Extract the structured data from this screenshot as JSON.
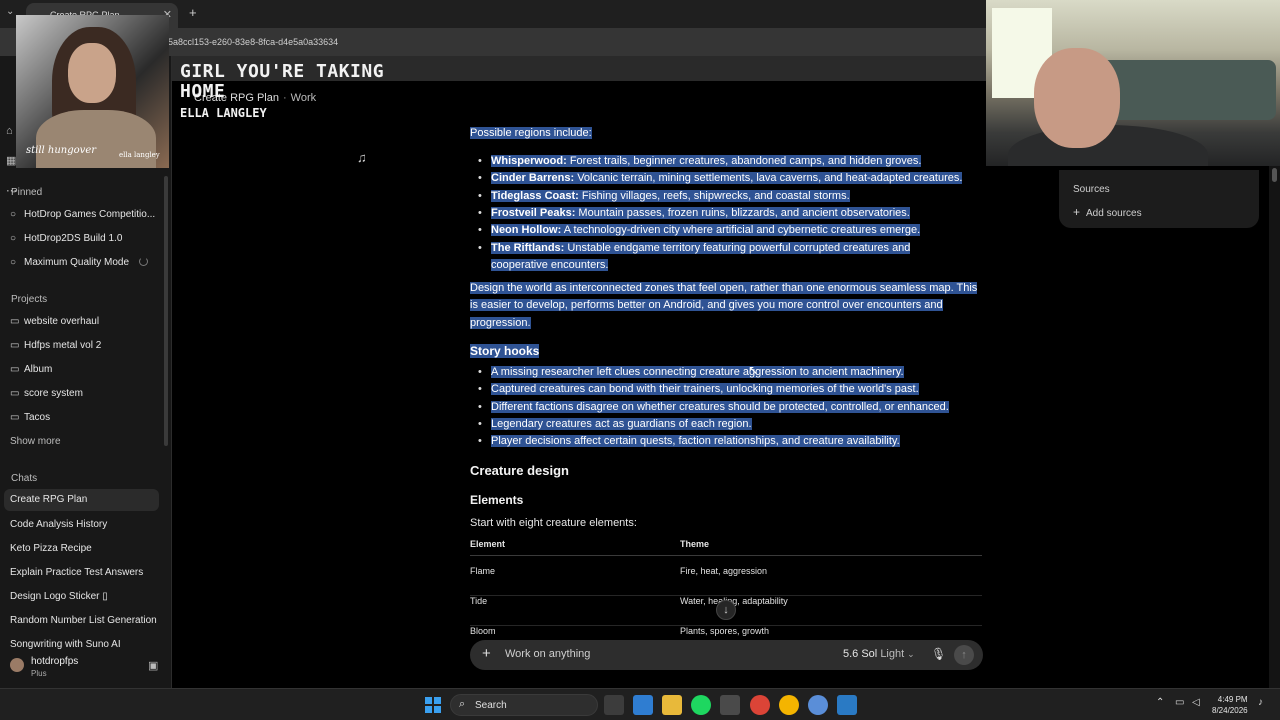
{
  "browser": {
    "tab_title": "Create RPG Plan",
    "url": "5a8ccl153-e260-83e8-8fca-d4e5a0a33634"
  },
  "overlay": {
    "song_title": "GIRL YOU'RE TAKING HOME",
    "song_artist": "ELLA LANGLEY",
    "album_script": "still hungover",
    "album_artist": "ella langley"
  },
  "breadcrumb": {
    "chat": "Create RPG Plan",
    "separator": "·",
    "project": "Work"
  },
  "sidebar": {
    "pinned_label": "Pinned",
    "pinned": [
      "HotDrop Games Competitio...",
      "HotDrop2DS Build 1.0",
      "Maximum Quality Mode"
    ],
    "projects_label": "Projects",
    "projects": [
      "website overhaul",
      "Hdfps metal vol 2",
      "Album",
      "score system",
      "Tacos"
    ],
    "show_more": "Show more",
    "chats_label": "Chats",
    "chats": [
      "Create RPG Plan",
      "Code Analysis History",
      "Keto Pizza Recipe",
      "Explain Practice Test Answers",
      "Design Logo Sticker ▯",
      "Random Number List Generation",
      "Songwriting with Suno AI"
    ],
    "user_name": "hotdropfps",
    "user_plan": "Plus"
  },
  "sources": {
    "title": "Sources",
    "add": "Add sources"
  },
  "content": {
    "regions_intro": "Possible regions include:",
    "regions": [
      {
        "name": "Whisperwood:",
        "text": " Forest trails, beginner creatures, abandoned camps, and hidden groves."
      },
      {
        "name": "Cinder Barrens:",
        "text": " Volcanic terrain, mining settlements, lava caverns, and heat-adapted creatures."
      },
      {
        "name": "Tideglass Coast:",
        "text": " Fishing villages, reefs, shipwrecks, and coastal storms."
      },
      {
        "name": "Frostveil Peaks:",
        "text": " Mountain passes, frozen ruins, blizzards, and ancient observatories."
      },
      {
        "name": "Neon Hollow:",
        "text": " A technology-driven city where artificial and cybernetic creatures emerge."
      },
      {
        "name": "The Riftlands:",
        "text": " Unstable endgame territory featuring powerful corrupted creatures and cooperative encounters."
      }
    ],
    "design_para": "Design the world as interconnected zones that feel open, rather than one enormous seamless map. This is easier to develop, performs better on Android, and gives you more control over encounters and progression.",
    "story_heading": "Story hooks",
    "story_hooks": [
      "A missing researcher left clues connecting creature aggression to ancient machinery.",
      "Captured creatures can bond with their trainers, unlocking memories of the world's past.",
      "Different factions disagree on whether creatures should be protected, controlled, or enhanced.",
      "Legendary creatures act as guardians of each region.",
      "Player decisions affect certain quests, faction relationships, and creature availability."
    ],
    "creature_heading": "Creature design",
    "elements_heading": "Elements",
    "elements_intro": "Start with eight creature elements:",
    "table_headers": [
      "Element",
      "Theme"
    ],
    "table_rows": [
      [
        "Flame",
        "Fire, heat, aggression"
      ],
      [
        "Tide",
        "Water, healing, adaptability"
      ],
      [
        "Bloom",
        "Plants, spores, growth"
      ]
    ]
  },
  "composer": {
    "placeholder": "Work on anything",
    "model": "5.6 Sol",
    "mode": "Light"
  },
  "taskbar": {
    "search_label": "Search",
    "time": "4:49 PM",
    "date": "8/24/2026"
  }
}
